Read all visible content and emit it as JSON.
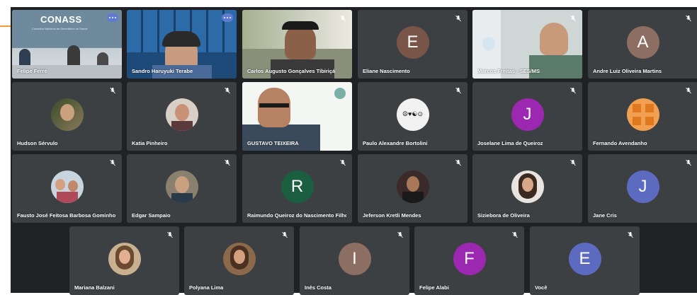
{
  "tiles": [
    {
      "name": "Felipe Ferré",
      "kind": "video"
    },
    {
      "name": "Sandro Haruyuki Terabe",
      "kind": "video"
    },
    {
      "name": "Carlos Augusto Gonçalves Tibiriçá",
      "kind": "video"
    },
    {
      "name": "Eliane Nascimento",
      "kind": "letter",
      "letter": "E",
      "color": "#795548"
    },
    {
      "name": "Marcos Freitas - SES/MS",
      "kind": "video"
    },
    {
      "name": "Andre Luiz Oliveira Martins",
      "kind": "letter",
      "letter": "A",
      "color": "#8d6e63"
    },
    {
      "name": "Hudson Sérvulo",
      "kind": "photo"
    },
    {
      "name": "Katia Pinheiro",
      "kind": "photo"
    },
    {
      "name": "GUSTAVO TEIXEIRA",
      "kind": "video"
    },
    {
      "name": "Paulo Alexandre Bortolini",
      "kind": "photo"
    },
    {
      "name": "Joselane Lima de Queiroz",
      "kind": "letter",
      "letter": "J",
      "color": "#9c27b0"
    },
    {
      "name": "Fernando Avendanho",
      "kind": "photo"
    },
    {
      "name": "Fausto José Feitosa Barbosa Gominho",
      "kind": "photo"
    },
    {
      "name": "Edgar Sampaio",
      "kind": "photo"
    },
    {
      "name": "Raimundo Queiroz do Nascimento Filho",
      "kind": "letter",
      "letter": "R",
      "color": "#1b5e40"
    },
    {
      "name": "Jeferson Kretli Mendes",
      "kind": "photo"
    },
    {
      "name": "Siziebora de Oliveira",
      "kind": "photo"
    },
    {
      "name": "Jane Cris",
      "kind": "letter",
      "letter": "J",
      "color": "#5c6bc0"
    },
    {
      "name": "Mariana Balzani",
      "kind": "photo"
    },
    {
      "name": "Polyana Lima",
      "kind": "photo"
    },
    {
      "name": "Inês Costa",
      "kind": "letter",
      "letter": "I",
      "color": "#8d6e63"
    },
    {
      "name": "Felipe Alabi",
      "kind": "letter",
      "letter": "F",
      "color": "#9c27b0"
    },
    {
      "name": "Você",
      "kind": "letter",
      "letter": "E",
      "color": "#5c6bc0"
    }
  ],
  "conass": {
    "logo": "CONASS",
    "subtitle": "Conselho Nacional de Secretários de Saúde"
  },
  "paulo_avatar_text": "☮♥☯⊙",
  "icons": {
    "mic": "mic-off-icon",
    "menu": "more-options-icon"
  }
}
